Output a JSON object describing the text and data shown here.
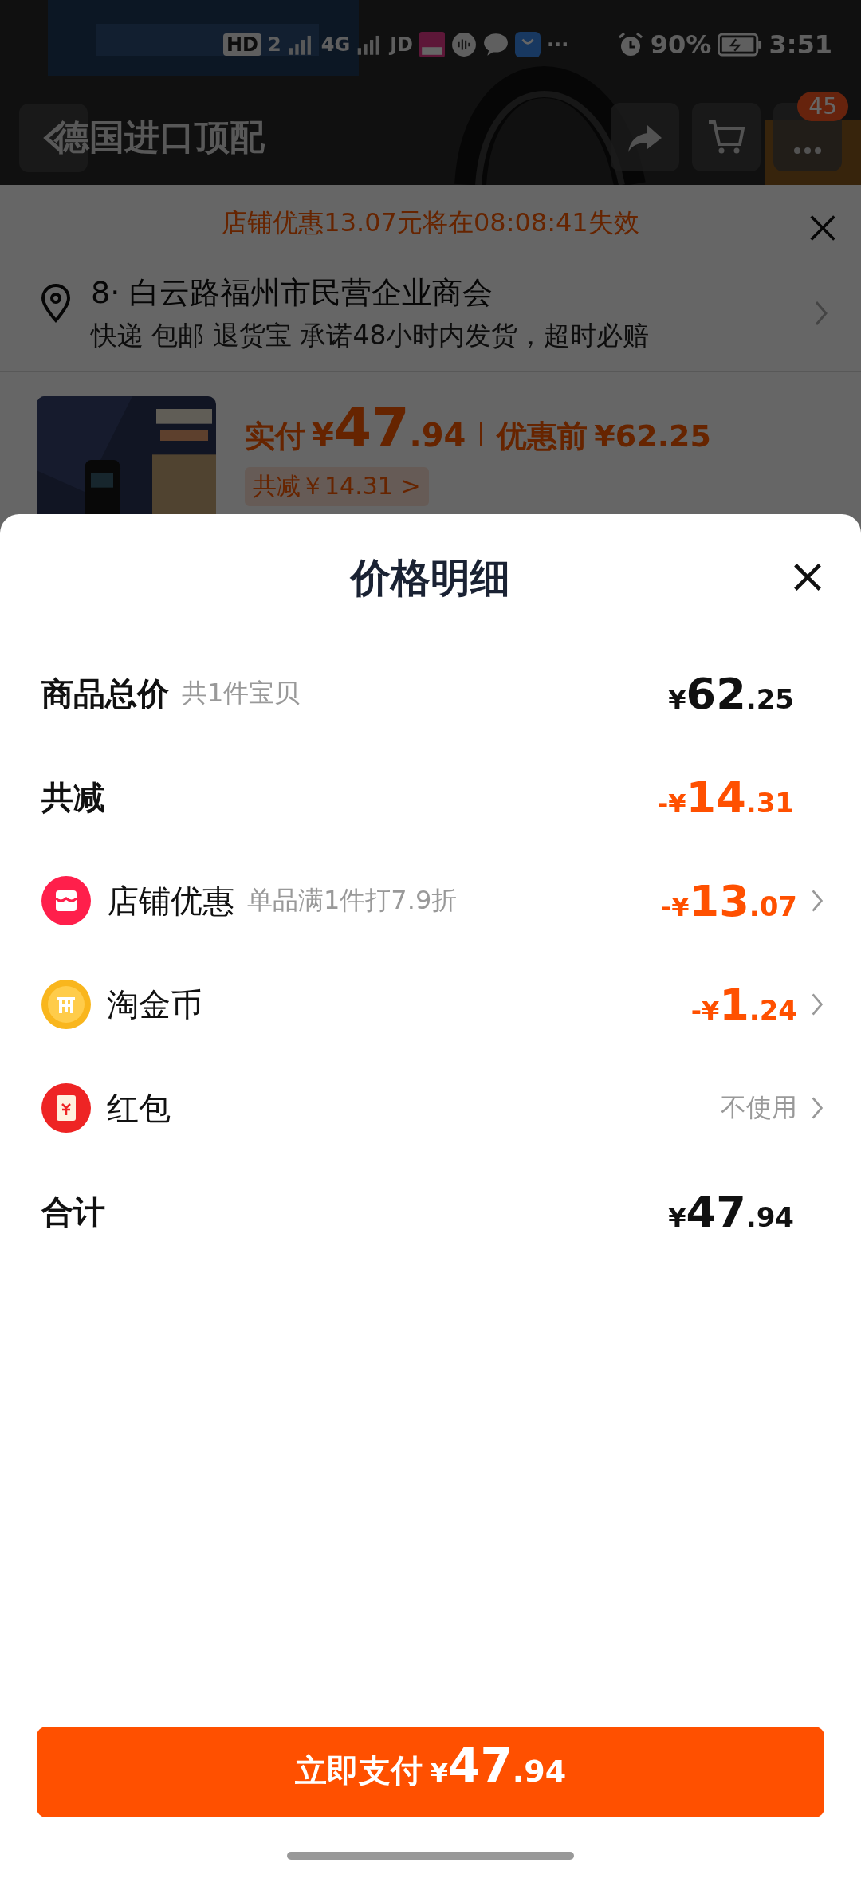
{
  "status_bar": {
    "network_labels": [
      "HD",
      "2",
      "4G",
      "JD"
    ],
    "more": "···",
    "battery": "90%",
    "time": "3:51"
  },
  "background_page": {
    "title": "德国进口顶配",
    "cart_badge": "45",
    "banner": "店铺优惠13.07元将在08:08:41失效",
    "address": {
      "line": "8· 白云路福州市民营企业商会",
      "services": "快递 包邮 退货宝 承诺48小时内发货，超时必赔"
    },
    "product": {
      "kind": "picture",
      "paid_label": "实付",
      "paid": "¥47.94",
      "before_label": "优惠前",
      "before": "¥62.25",
      "saved": "共减￥14.31 >"
    }
  },
  "sheet": {
    "title": "价格明细",
    "rows": [
      {
        "kind": "total",
        "label": "商品总价",
        "note": "共1件宝贝",
        "amount": "¥62.25",
        "chevron": false
      },
      {
        "kind": "deduction",
        "label": "共减",
        "amount": "-¥14.31",
        "chevron": false
      },
      {
        "kind": "shop",
        "label": "店铺优惠",
        "note": "单品满1件打7.9折",
        "amount": "-¥13.07",
        "chevron": true
      },
      {
        "kind": "coin",
        "label": "淘金币",
        "amount": "-¥1.24",
        "chevron": true
      },
      {
        "kind": "packet",
        "label": "红包",
        "amount": "不使用",
        "chevron": true
      },
      {
        "kind": "total",
        "label": "合计",
        "amount": "¥47.94",
        "chevron": false
      }
    ],
    "pay_button": {
      "label": "立即支付",
      "amount": "¥47.94"
    }
  }
}
